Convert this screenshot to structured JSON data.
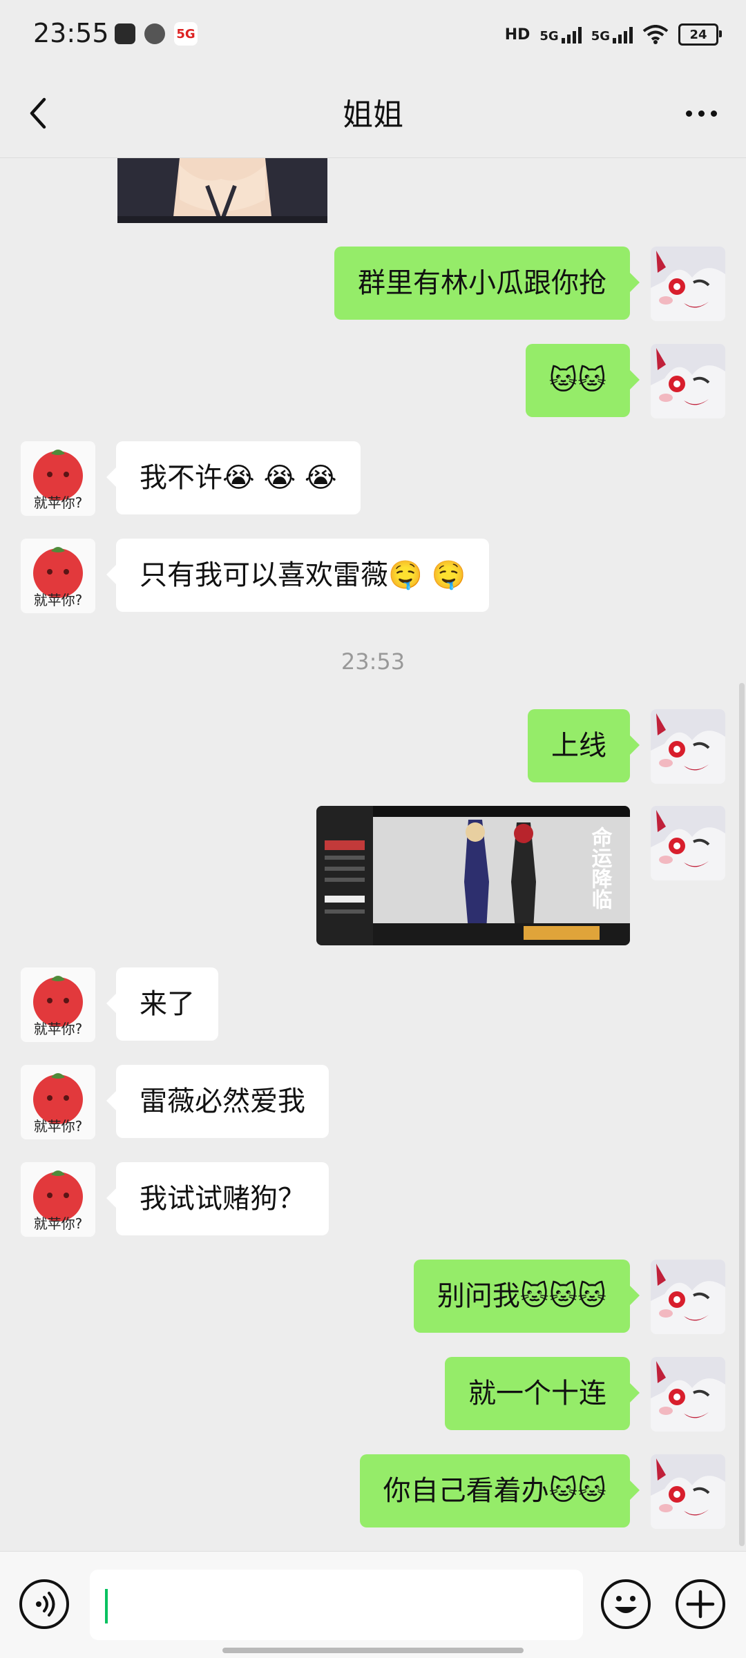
{
  "status_bar": {
    "time": "23:55",
    "hd_label": "HD",
    "net1": "5G",
    "net2": "5G",
    "battery": "24"
  },
  "header": {
    "title": "姐姐"
  },
  "timestamp": "23:53",
  "messages": [
    {
      "side": "out",
      "text": "群里有林小瓜跟你抢"
    },
    {
      "side": "out",
      "text": "🐱🐱"
    },
    {
      "side": "in",
      "text": "我不许😭 😭 😭"
    },
    {
      "side": "in",
      "text": "只有我可以喜欢雷薇🤤 🤤"
    },
    {
      "side": "out",
      "text": "上线"
    },
    {
      "side": "out",
      "type": "image",
      "caption": "命运降临"
    },
    {
      "side": "in",
      "text": "来了"
    },
    {
      "side": "in",
      "text": "雷薇必然爱我"
    },
    {
      "side": "in",
      "text": "我试试赌狗？"
    },
    {
      "side": "out",
      "text": "别问我🐱🐱🐱"
    },
    {
      "side": "out",
      "text": "就一个十连"
    },
    {
      "side": "out",
      "text": "你自己看着办🐱🐱"
    }
  ],
  "friend_avatar_text": "就苹你?",
  "colors": {
    "out_bubble": "#95ec69",
    "in_bubble": "#ffffff",
    "background": "#ededed",
    "caret": "#07c160"
  },
  "icons": {
    "back": "chevron-left-icon",
    "more": "more-dots-icon",
    "voice": "voice-icon",
    "emoji": "smiley-icon",
    "plus": "plus-icon"
  }
}
